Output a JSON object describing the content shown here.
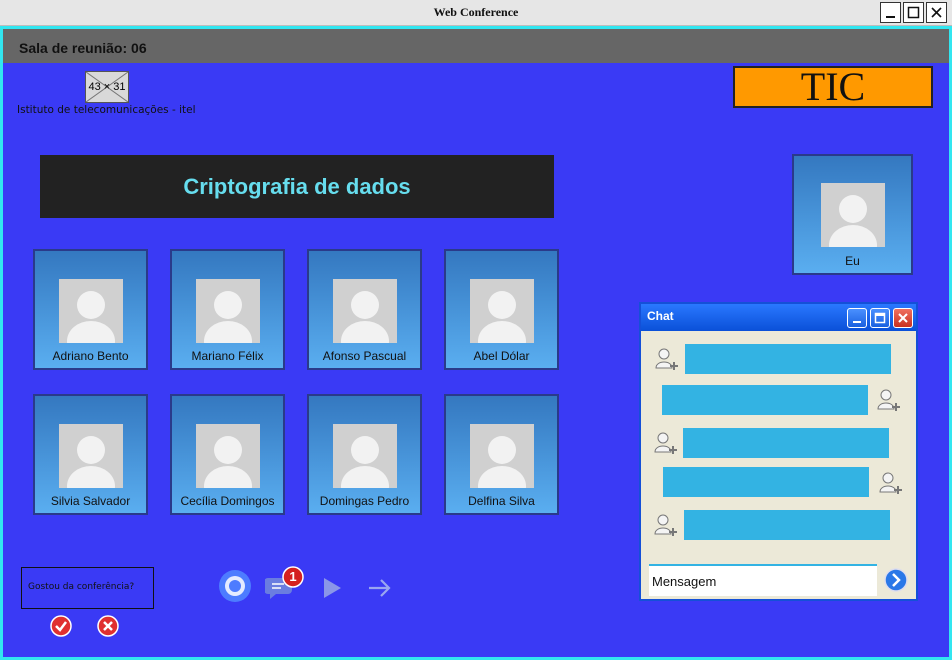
{
  "window": {
    "title": "Web Conference"
  },
  "room": {
    "title": "Sala de reunião: 06"
  },
  "logo": {
    "placeholder": "43 × 31",
    "org_name": "Istituto de telecomunicações - itel"
  },
  "brand": {
    "label": "TIC",
    "color": "#ff9900"
  },
  "topic": {
    "title": "Criptografia de dados"
  },
  "participants": [
    {
      "name": "Adriano Bento"
    },
    {
      "name": "Mariano Félix"
    },
    {
      "name": "Afonso Pascual"
    },
    {
      "name": "Abel Dólar"
    },
    {
      "name": "Silvia Salvador"
    },
    {
      "name": "Cecília Domingos"
    },
    {
      "name": "Domingas Pedro"
    },
    {
      "name": "Delfina Silva"
    }
  ],
  "self": {
    "name": "Eu"
  },
  "chat": {
    "title": "Chat",
    "input_placeholder": "Mensagem",
    "messages": [
      {
        "side": "left",
        "icon": "add-user-icon"
      },
      {
        "side": "right",
        "icon": "add-user-icon"
      },
      {
        "side": "left",
        "icon": "add-user-icon"
      },
      {
        "side": "right",
        "icon": "add-user-icon"
      },
      {
        "side": "left",
        "icon": "add-user-icon"
      }
    ]
  },
  "feedback": {
    "question": "Gostou da conferência?"
  },
  "controls": {
    "unread_count": "1"
  },
  "colors": {
    "background": "#3a3af5",
    "frame_border": "#32e6f0",
    "chat_bubble": "#33b3e3",
    "topic_text": "#66ddee"
  }
}
